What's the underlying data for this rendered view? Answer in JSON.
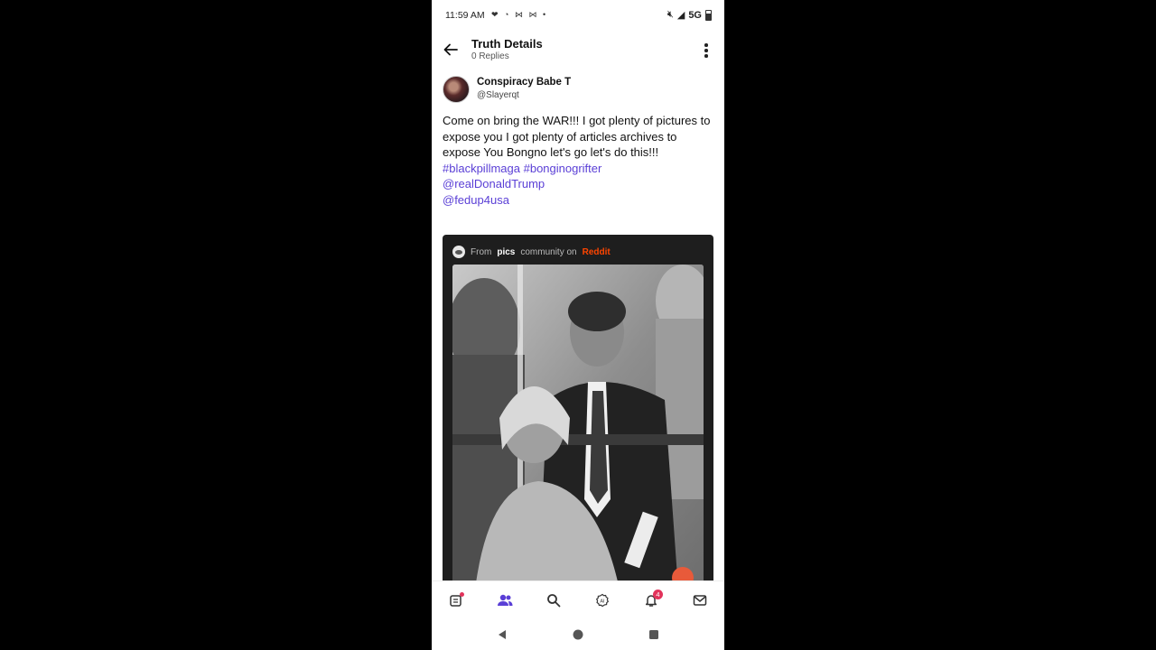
{
  "status_bar": {
    "time": "11:59 AM",
    "network": "5G",
    "left_icons": [
      "notification-icons"
    ],
    "right_icons": [
      "mute-icon",
      "signal-icon",
      "battery-icon"
    ]
  },
  "header": {
    "title": "Truth Details",
    "subtitle": "0 Replies",
    "back_icon": "arrow-left-icon",
    "menu_icon": "kebab-menu-icon"
  },
  "post": {
    "author_name": "Conspiracy Babe T",
    "author_handle": "@Slayerqt",
    "text": "Come on bring the WAR!!! I got plenty of pictures to expose you I got plenty of articles archives to expose You Bongno let's go let's do this!!!",
    "hashtag_line": "#blackpillmaga #bonginogrifter",
    "mention_1": "@realDonaldTrump",
    "mention_2": "@fedup4usa",
    "embed": {
      "prefix": "From",
      "community": "pics",
      "middle": "community on",
      "source": "Reddit"
    }
  },
  "bottom_nav": {
    "items": [
      "feed-icon",
      "people-icon",
      "search-icon",
      "ai-icon",
      "bell-icon",
      "mail-icon"
    ],
    "notifications_count": "4",
    "active": "people-icon"
  },
  "colors": {
    "link": "#5a3fd6",
    "accent": "#5a3fd6",
    "badge": "#e2335b",
    "reddit": "#ff4500"
  }
}
